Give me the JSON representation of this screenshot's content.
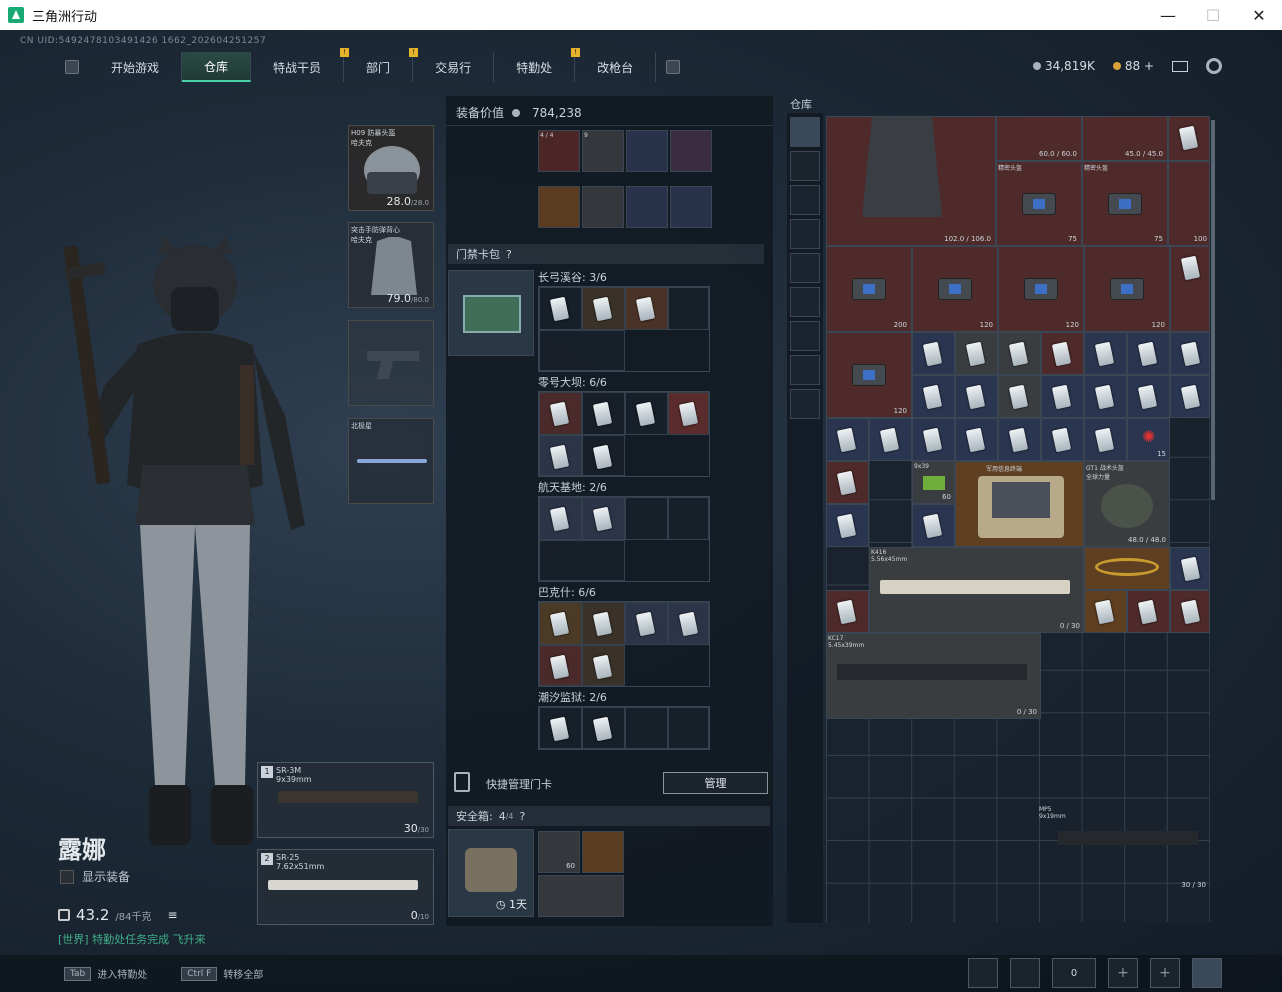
{
  "window": {
    "title": "三角洲行动",
    "minimize": "—",
    "maximize": "☐",
    "close": "✕"
  },
  "uid": "CN UID:5492478103491426 1662_202604251257",
  "nav": {
    "tabs": [
      "开始游戏",
      "仓库",
      "特战干员",
      "部门",
      "交易行",
      "特勤处",
      "改枪台"
    ],
    "active": 1,
    "badge": "!"
  },
  "currency": {
    "silver": "34,819K",
    "gold": "88",
    "plus": "+"
  },
  "character": {
    "name": "露娜",
    "show_gear": "显示装备",
    "weight": "43.2",
    "weight_max": "/84千克",
    "notice": "[世界] 特勤处任务完成 飞升来"
  },
  "gear": {
    "helmet": {
      "name": "H09 防暴头盔",
      "sub": "哈夫克",
      "dur": "28.0",
      "max": "/28.0"
    },
    "armor": {
      "name": "突击手防弹背心",
      "sub": "哈夫克",
      "dur": "79.0",
      "max": "/80.0"
    },
    "knife": {
      "name": "北极星"
    }
  },
  "weapons": [
    {
      "num": "1",
      "name": "SR-3M",
      "cal": "9x39mm",
      "ammo": "30",
      "max": "/30"
    },
    {
      "num": "2",
      "name": "SR-25",
      "cal": "7.62x51mm",
      "ammo": "0",
      "max": "/10"
    }
  ],
  "equip_value": {
    "label": "装备价值",
    "value": "784,238"
  },
  "keycard": {
    "header": "门禁卡包",
    "help": "?",
    "maps": [
      {
        "name": "长弓溪谷: 3/6"
      },
      {
        "name": "零号大坝: 6/6"
      },
      {
        "name": "航天基地: 2/6"
      },
      {
        "name": "巴克什: 6/6"
      },
      {
        "name": "潮汐监狱: 2/6"
      }
    ],
    "quick_label": "快捷管理门卡",
    "manage_btn": "管理"
  },
  "safe": {
    "label": "安全箱:",
    "count": "4",
    "max": "/4",
    "help": "?",
    "duration": "1天",
    "slot_ammo": "60"
  },
  "backpack_top": {
    "counts": [
      "4 / 4",
      "9"
    ]
  },
  "storage": {
    "header": "仓库",
    "helmet_dur": "60.0 / 60.0",
    "helmet2_dur": "45.0 / 45.0",
    "vest_dur": "102.0 / 106.0",
    "bag_label": "精密头盔",
    "counts": [
      "75",
      "75",
      "100",
      "200",
      "120",
      "120",
      "120",
      "120",
      "120",
      "15",
      "60",
      "48.0 / 48.0",
      "0 / 30",
      "0 / 30",
      "30 / 30"
    ],
    "weapons": [
      {
        "name": "K416",
        "cal": "5.56x45mm",
        "ammo": "0 / 30"
      },
      {
        "name": "KC17",
        "cal": "5.45x39mm",
        "ammo": "0 / 30"
      },
      {
        "name": "MP5",
        "cal": "9x19mm",
        "ammo": "30 / 30"
      }
    ],
    "gt1": "GT1 战术头盔",
    "gt1_sub": "全球力量",
    "gt1_dur": "48.0 / 48.0",
    "cal939": "9x39",
    "terminal": "军用信息终端"
  },
  "bottom": {
    "hint1_key": "Tab",
    "hint1": "进入特勤处",
    "hint2_key": "Ctrl F",
    "hint2": "转移全部",
    "friends": "0"
  }
}
